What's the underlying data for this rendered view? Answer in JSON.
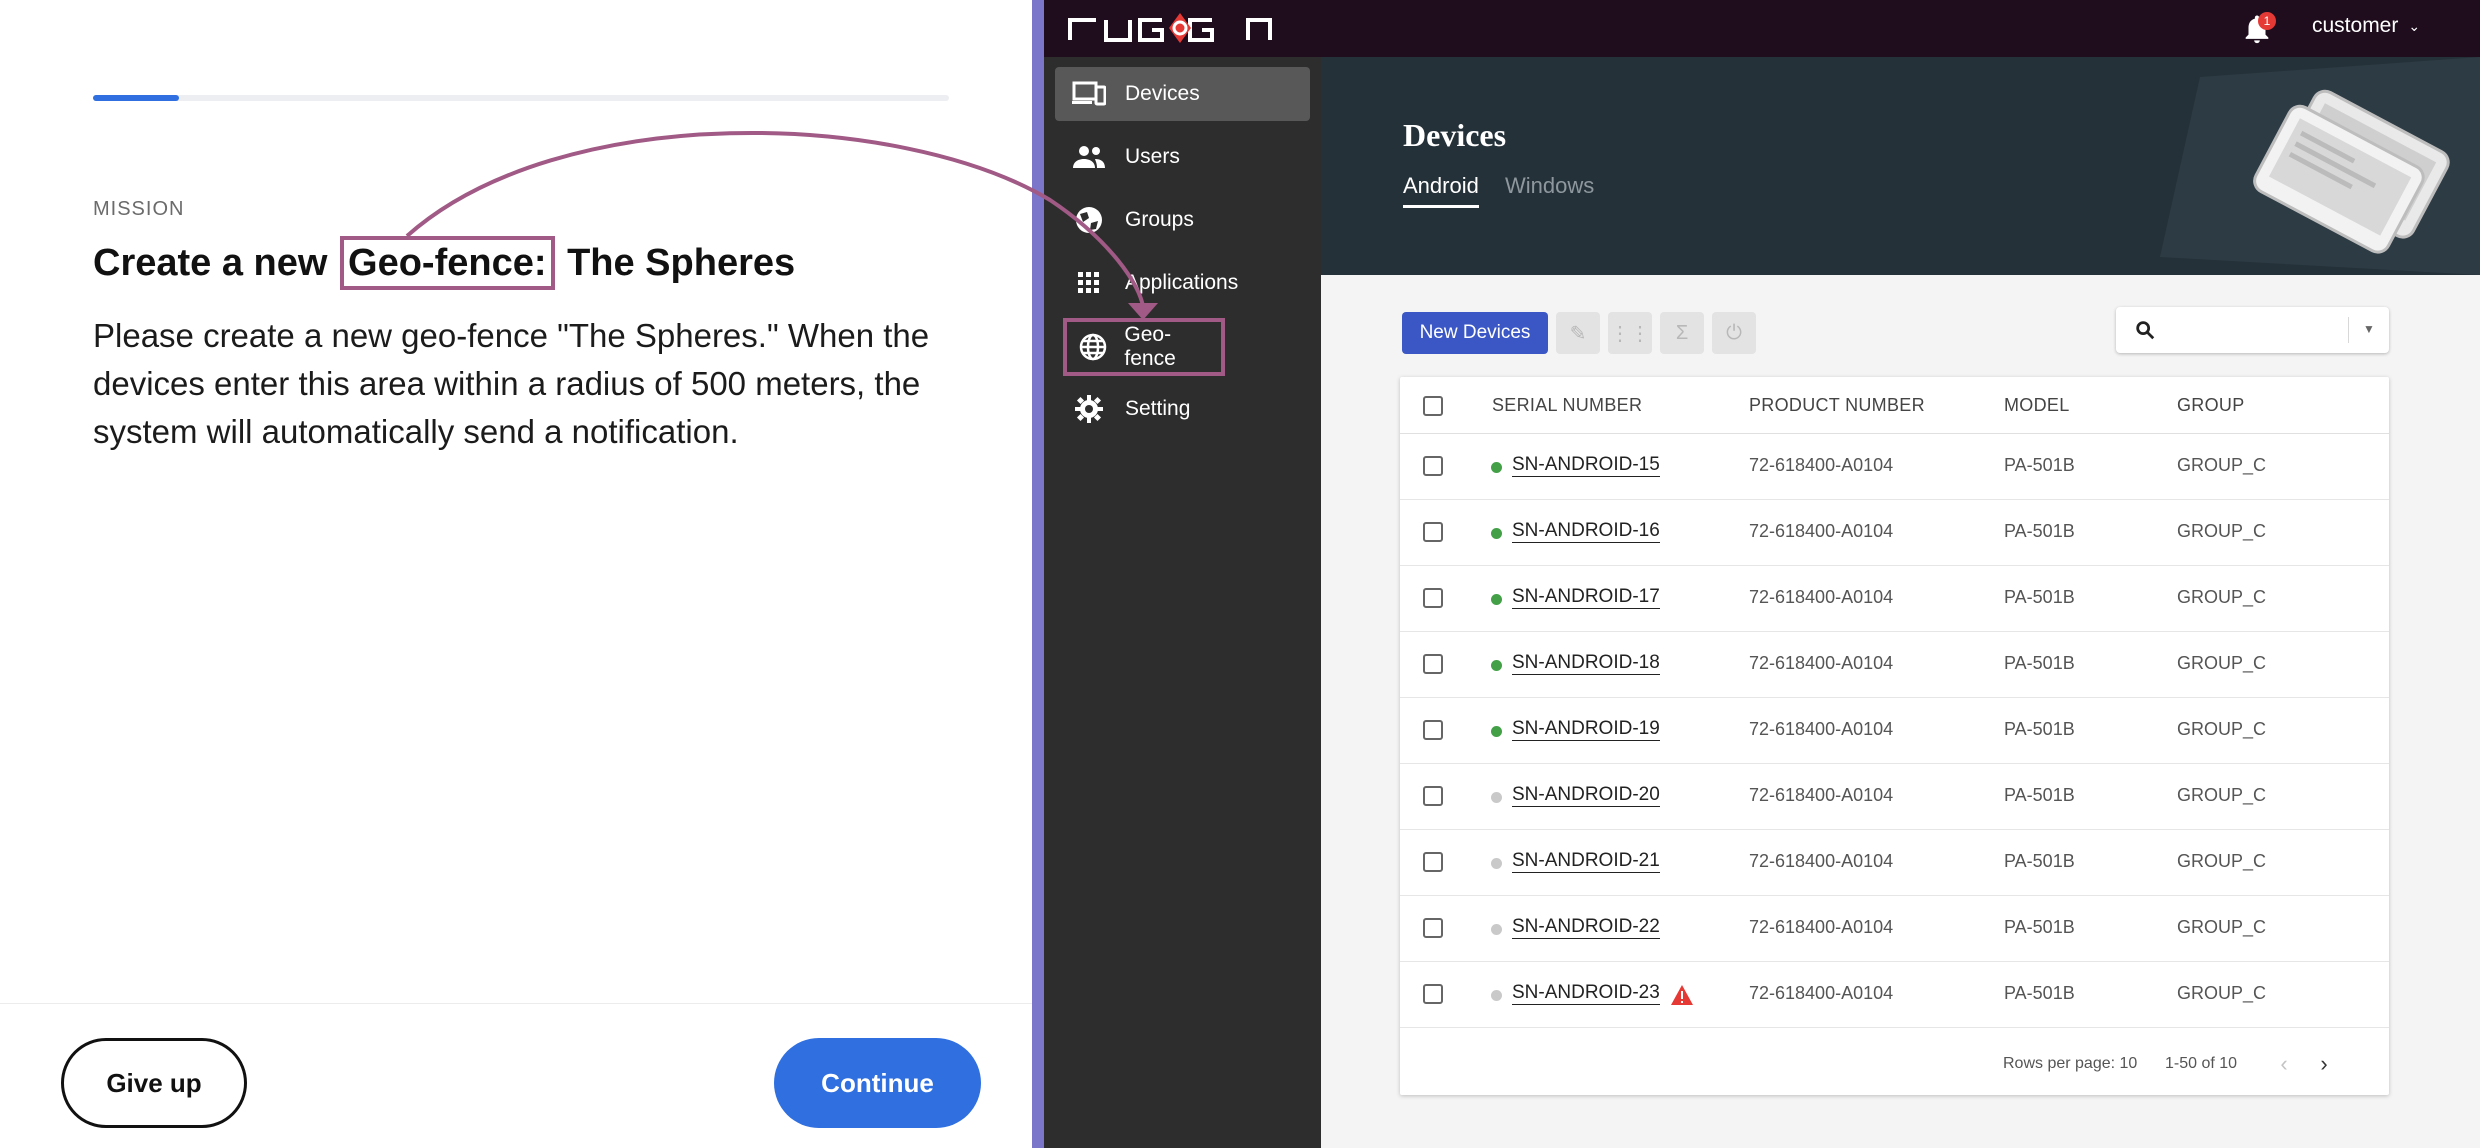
{
  "mission": {
    "progress_percent": 10,
    "label": "MISSION",
    "title_before": "Create a new",
    "title_highlight": "Geo-fence:",
    "title_after": "The Spheres",
    "description": "Please create a new geo-fence \"The Spheres.\" When the devices enter this area within a radius of 500 meters, the system will automatically send a notification.",
    "give_up_label": "Give up",
    "continue_label": "Continue"
  },
  "header": {
    "logo_icon": "ruggon-logo",
    "notification_count": "1",
    "user_name": "customer"
  },
  "sidebar": {
    "items": [
      {
        "label": "Devices",
        "icon": "devices-icon",
        "active": true
      },
      {
        "label": "Users",
        "icon": "users-icon"
      },
      {
        "label": "Groups",
        "icon": "groups-icon"
      },
      {
        "label": "Applications",
        "icon": "applications-icon"
      },
      {
        "label": "Geo-fence",
        "icon": "globe-icon",
        "highlighted": true
      },
      {
        "label": "Setting",
        "icon": "gear-icon"
      }
    ]
  },
  "page": {
    "title": "Devices",
    "tabs": [
      {
        "label": "Android",
        "active": true
      },
      {
        "label": "Windows",
        "active": false
      }
    ]
  },
  "toolbar": {
    "new_devices_label": "New Devices",
    "icons": [
      "edit-icon",
      "grid-icon",
      "sigma-icon",
      "power-icon"
    ],
    "search_placeholder": ""
  },
  "table": {
    "columns": [
      "SERIAL NUMBER",
      "PRODUCT NUMBER",
      "MODEL",
      "GROUP"
    ],
    "rows": [
      {
        "serial": "SN-ANDROID-15",
        "product": "72-618400-A0104",
        "model": "PA-501B",
        "group": "GROUP_C",
        "status": "online",
        "warning": false
      },
      {
        "serial": "SN-ANDROID-16",
        "product": "72-618400-A0104",
        "model": "PA-501B",
        "group": "GROUP_C",
        "status": "online",
        "warning": false
      },
      {
        "serial": "SN-ANDROID-17",
        "product": "72-618400-A0104",
        "model": "PA-501B",
        "group": "GROUP_C",
        "status": "online",
        "warning": false
      },
      {
        "serial": "SN-ANDROID-18",
        "product": "72-618400-A0104",
        "model": "PA-501B",
        "group": "GROUP_C",
        "status": "online",
        "warning": false
      },
      {
        "serial": "SN-ANDROID-19",
        "product": "72-618400-A0104",
        "model": "PA-501B",
        "group": "GROUP_C",
        "status": "online",
        "warning": false
      },
      {
        "serial": "SN-ANDROID-20",
        "product": "72-618400-A0104",
        "model": "PA-501B",
        "group": "GROUP_C",
        "status": "offline",
        "warning": false
      },
      {
        "serial": "SN-ANDROID-21",
        "product": "72-618400-A0104",
        "model": "PA-501B",
        "group": "GROUP_C",
        "status": "offline",
        "warning": false
      },
      {
        "serial": "SN-ANDROID-22",
        "product": "72-618400-A0104",
        "model": "PA-501B",
        "group": "GROUP_C",
        "status": "offline",
        "warning": false
      },
      {
        "serial": "SN-ANDROID-23",
        "product": "72-618400-A0104",
        "model": "PA-501B",
        "group": "GROUP_C",
        "status": "offline",
        "warning": true
      }
    ],
    "footer": {
      "rows_per_page": "Rows per page: 10",
      "range": "1-50 of 10"
    }
  },
  "colors": {
    "accent_blue": "#2f6fe0",
    "highlight": "#a05a85",
    "online": "#43a047",
    "offline": "#c9c9c9",
    "warning": "#e53935"
  }
}
